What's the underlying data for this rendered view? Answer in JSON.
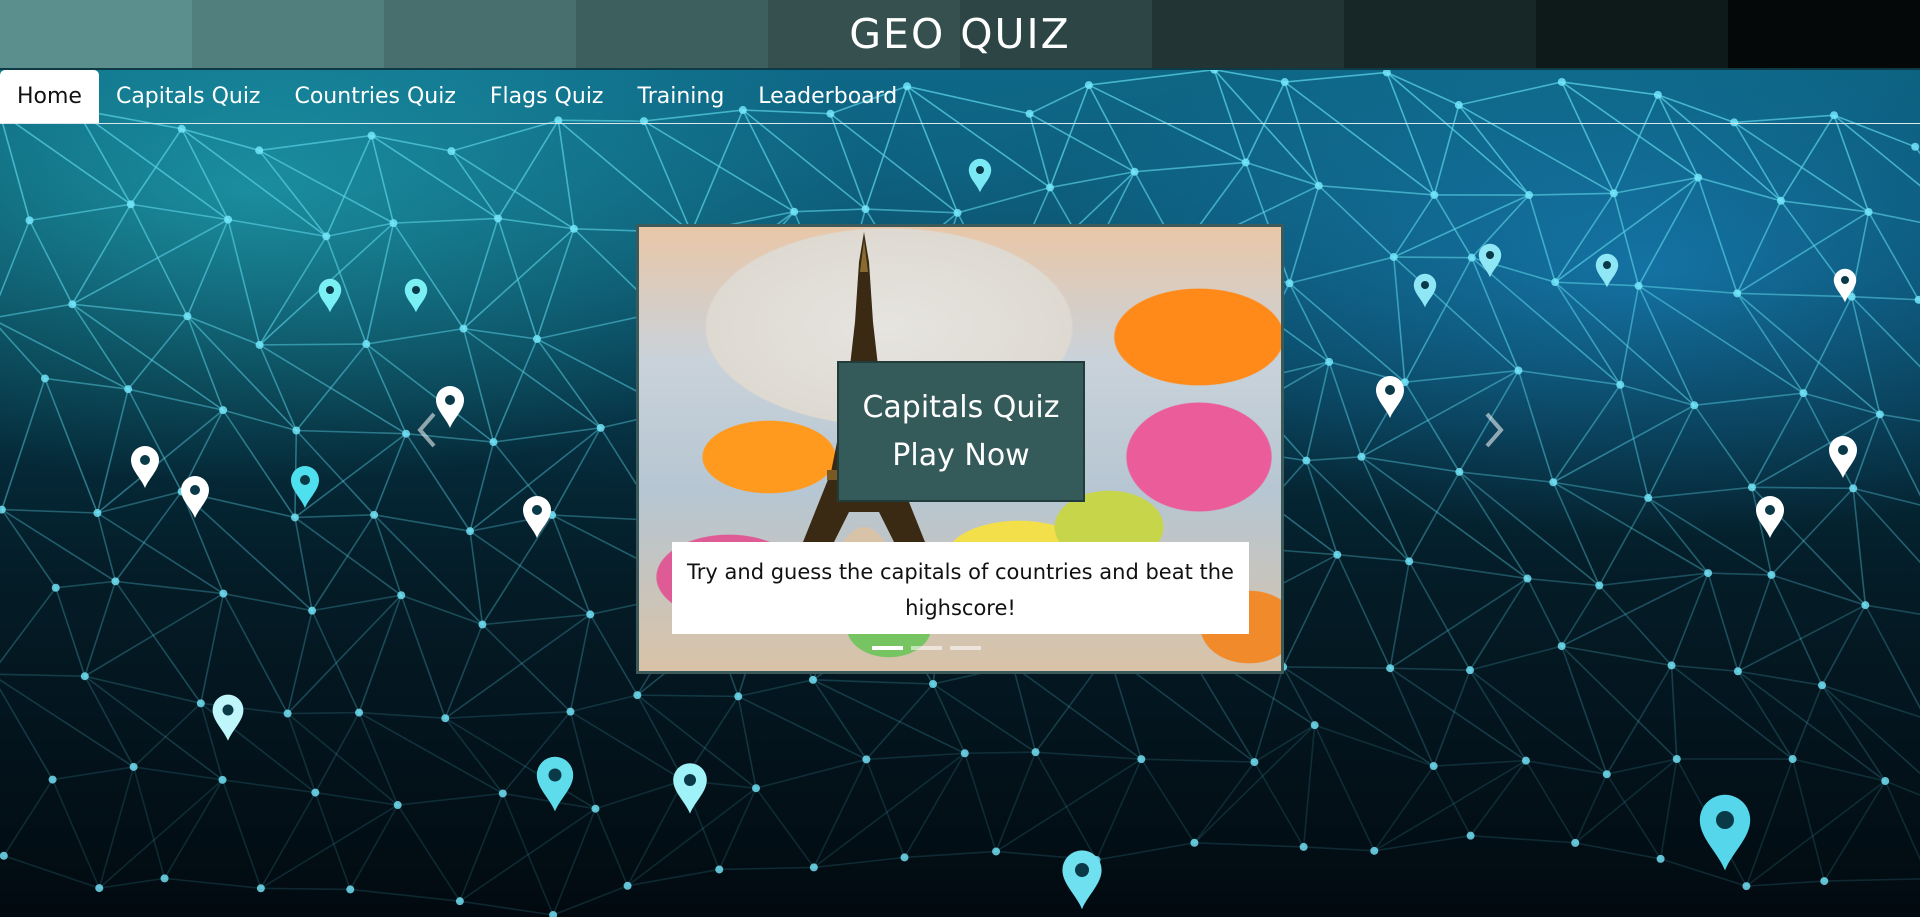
{
  "header": {
    "title": "GEO QUIZ",
    "band_colors": [
      "#5a8f8d",
      "#507f7e",
      "#486f6e",
      "#3d5f5e",
      "#35504f",
      "#2d4544",
      "#223434",
      "#172626",
      "#0e1919",
      "#050808"
    ]
  },
  "nav": {
    "items": [
      {
        "label": "Home",
        "active": true
      },
      {
        "label": "Capitals Quiz",
        "active": false
      },
      {
        "label": "Countries Quiz",
        "active": false
      },
      {
        "label": "Flags Quiz",
        "active": false
      },
      {
        "label": "Training",
        "active": false
      },
      {
        "label": "Leaderboard",
        "active": false
      }
    ]
  },
  "carousel": {
    "card_line1": "Capitals Quiz",
    "card_line2": "Play Now",
    "caption": "Try and guess the capitals of countries and beat the highscore!",
    "slides": 3,
    "active_slide": 1,
    "prev_icon": "chevron-left-icon",
    "next_icon": "chevron-right-icon"
  },
  "colors": {
    "accent": "#355a5a",
    "nav_active_bg": "#ffffff"
  }
}
